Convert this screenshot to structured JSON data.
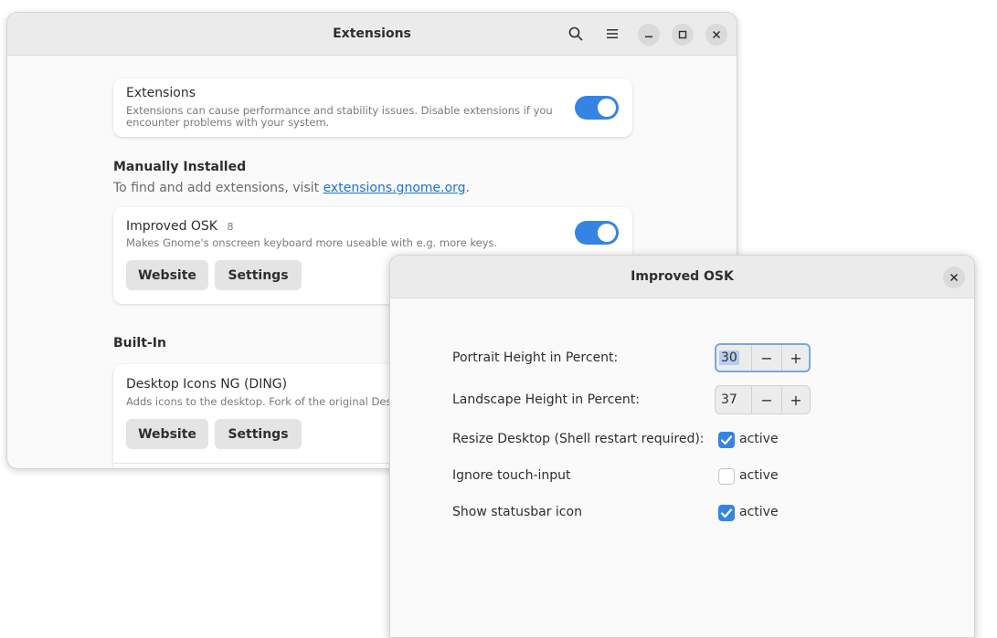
{
  "main_window": {
    "title": "Extensions",
    "extensions_toggle": {
      "title": "Extensions",
      "description_line1": "Extensions can cause performance and stability issues. Disable extensions if you",
      "description_line2": "encounter problems with your system.",
      "enabled": true
    },
    "manual_section": {
      "heading": "Manually Installed",
      "sub_prefix": "To find and add extensions, visit ",
      "sub_link": "extensions.gnome.org",
      "sub_suffix": "."
    },
    "improved_osk": {
      "name": "Improved OSK",
      "version": "8",
      "description": "Makes Gnome's onscreen keyboard more useable with e.g. more keys.",
      "website_label": "Website",
      "settings_label": "Settings",
      "enabled": true
    },
    "builtin_section": {
      "heading": "Built-In"
    },
    "ding": {
      "name": "Desktop Icons NG (DING)",
      "description": "Adds icons to the desktop. Fork of the original Deskt",
      "website_label": "Website",
      "settings_label": "Settings"
    }
  },
  "dialog": {
    "title": "Improved OSK",
    "portrait": {
      "label": "Portrait Height in Percent:",
      "value": "30",
      "minus": "−",
      "plus": "+"
    },
    "landscape": {
      "label": "Landscape Height in Percent:",
      "value": "37",
      "minus": "−",
      "plus": "+"
    },
    "resize_desktop": {
      "label": "Resize Desktop (Shell restart required):",
      "state_label": "active",
      "checked": true
    },
    "ignore_touch": {
      "label": "Ignore touch-input",
      "state_label": "active",
      "checked": false
    },
    "statusbar_icon": {
      "label": "Show statusbar icon",
      "state_label": "active",
      "checked": true
    }
  },
  "colors": {
    "accent": "#3584e4",
    "link": "#1c71d8"
  },
  "icons": [
    "search-icon",
    "menu-icon",
    "minimize-icon",
    "maximize-icon",
    "close-icon",
    "checkmark-icon"
  ]
}
